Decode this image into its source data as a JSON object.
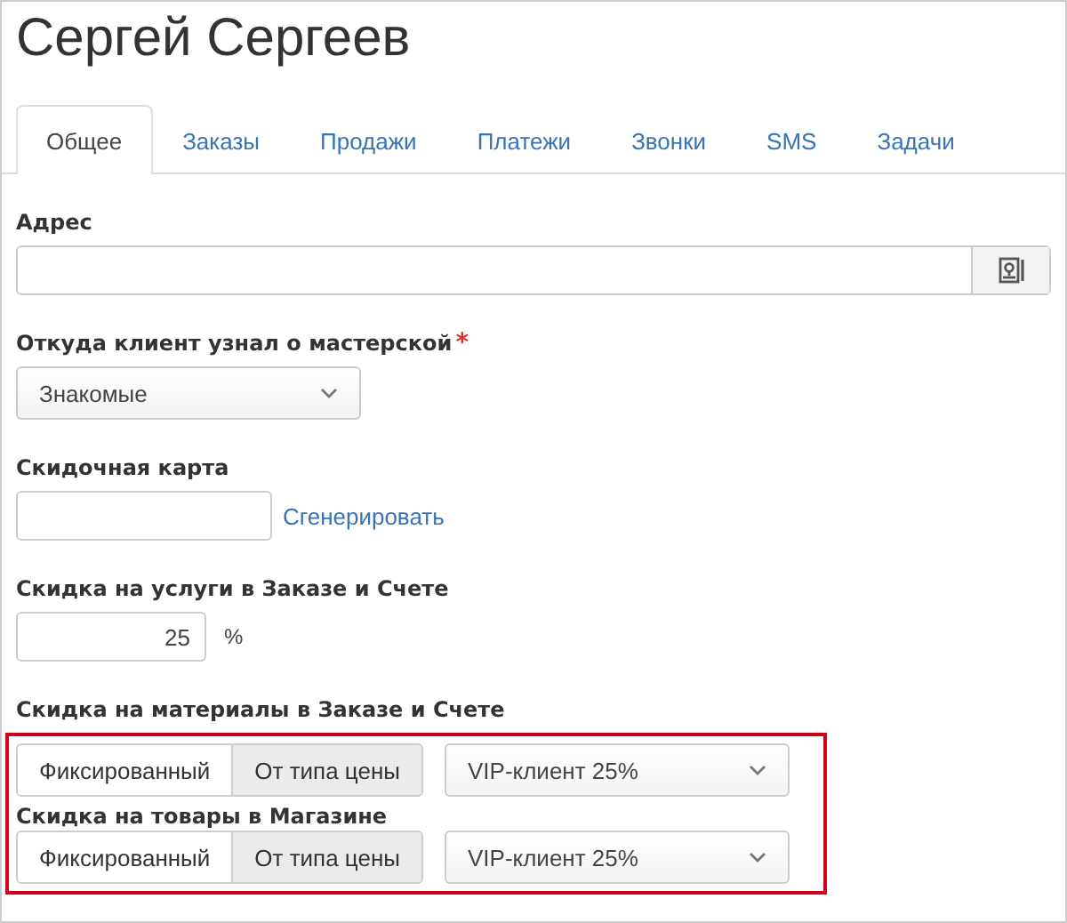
{
  "title": "Сергей Сергеев",
  "tabs": [
    {
      "label": "Общее",
      "selected": true
    },
    {
      "label": "Заказы",
      "selected": false
    },
    {
      "label": "Продажи",
      "selected": false
    },
    {
      "label": "Платежи",
      "selected": false
    },
    {
      "label": "Звонки",
      "selected": false
    },
    {
      "label": "SMS",
      "selected": false
    },
    {
      "label": "Задачи",
      "selected": false
    }
  ],
  "address": {
    "label": "Адрес"
  },
  "source": {
    "label": "Откуда клиент узнал о мастерской",
    "required_mark": "*",
    "value": "Знакомые"
  },
  "card": {
    "label": "Скидочная карта",
    "link": "Сгенерировать"
  },
  "service_discount": {
    "label": "Скидка на услуги в Заказе и Счете",
    "value": "25",
    "unit": "%"
  },
  "highlighted_groups": [
    {
      "label": "Скидка на материалы в Заказе и Счете",
      "options": [
        {
          "label": "Фиксированный",
          "selected": false
        },
        {
          "label": "От типа цены",
          "selected": true
        }
      ],
      "value": "VIP-клиент 25%"
    },
    {
      "label": "Скидка на товары в Магазине",
      "options": [
        {
          "label": "Фиксированный",
          "selected": false
        },
        {
          "label": "От типа цены",
          "selected": true
        }
      ],
      "value": "VIP-клиент 25%"
    }
  ]
}
